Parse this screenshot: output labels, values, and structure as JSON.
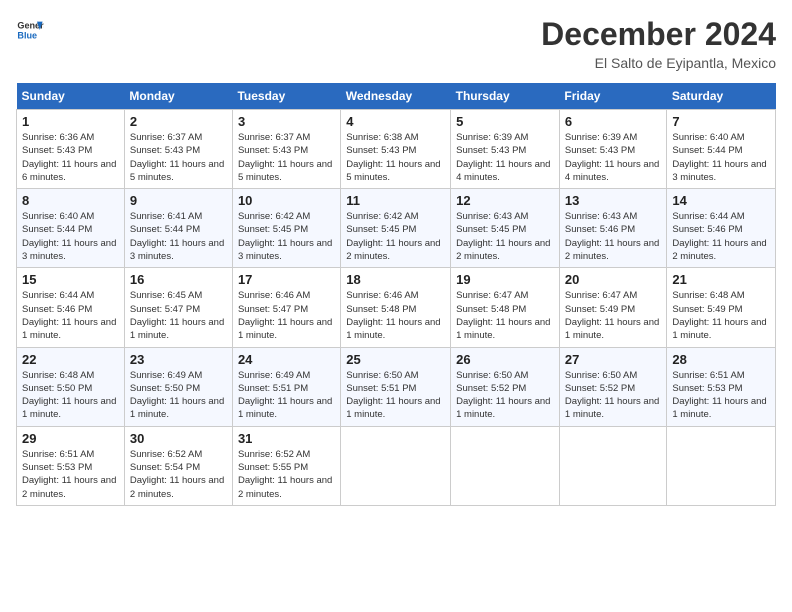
{
  "logo": {
    "general": "General",
    "blue": "Blue"
  },
  "title": "December 2024",
  "location": "El Salto de Eyipantla, Mexico",
  "days_of_week": [
    "Sunday",
    "Monday",
    "Tuesday",
    "Wednesday",
    "Thursday",
    "Friday",
    "Saturday"
  ],
  "weeks": [
    [
      {
        "day": "1",
        "sunrise": "6:36 AM",
        "sunset": "5:43 PM",
        "daylight": "11 hours and 6 minutes."
      },
      {
        "day": "2",
        "sunrise": "6:37 AM",
        "sunset": "5:43 PM",
        "daylight": "11 hours and 5 minutes."
      },
      {
        "day": "3",
        "sunrise": "6:37 AM",
        "sunset": "5:43 PM",
        "daylight": "11 hours and 5 minutes."
      },
      {
        "day": "4",
        "sunrise": "6:38 AM",
        "sunset": "5:43 PM",
        "daylight": "11 hours and 5 minutes."
      },
      {
        "day": "5",
        "sunrise": "6:39 AM",
        "sunset": "5:43 PM",
        "daylight": "11 hours and 4 minutes."
      },
      {
        "day": "6",
        "sunrise": "6:39 AM",
        "sunset": "5:43 PM",
        "daylight": "11 hours and 4 minutes."
      },
      {
        "day": "7",
        "sunrise": "6:40 AM",
        "sunset": "5:44 PM",
        "daylight": "11 hours and 3 minutes."
      }
    ],
    [
      {
        "day": "8",
        "sunrise": "6:40 AM",
        "sunset": "5:44 PM",
        "daylight": "11 hours and 3 minutes."
      },
      {
        "day": "9",
        "sunrise": "6:41 AM",
        "sunset": "5:44 PM",
        "daylight": "11 hours and 3 minutes."
      },
      {
        "day": "10",
        "sunrise": "6:42 AM",
        "sunset": "5:45 PM",
        "daylight": "11 hours and 3 minutes."
      },
      {
        "day": "11",
        "sunrise": "6:42 AM",
        "sunset": "5:45 PM",
        "daylight": "11 hours and 2 minutes."
      },
      {
        "day": "12",
        "sunrise": "6:43 AM",
        "sunset": "5:45 PM",
        "daylight": "11 hours and 2 minutes."
      },
      {
        "day": "13",
        "sunrise": "6:43 AM",
        "sunset": "5:46 PM",
        "daylight": "11 hours and 2 minutes."
      },
      {
        "day": "14",
        "sunrise": "6:44 AM",
        "sunset": "5:46 PM",
        "daylight": "11 hours and 2 minutes."
      }
    ],
    [
      {
        "day": "15",
        "sunrise": "6:44 AM",
        "sunset": "5:46 PM",
        "daylight": "11 hours and 1 minute."
      },
      {
        "day": "16",
        "sunrise": "6:45 AM",
        "sunset": "5:47 PM",
        "daylight": "11 hours and 1 minute."
      },
      {
        "day": "17",
        "sunrise": "6:46 AM",
        "sunset": "5:47 PM",
        "daylight": "11 hours and 1 minute."
      },
      {
        "day": "18",
        "sunrise": "6:46 AM",
        "sunset": "5:48 PM",
        "daylight": "11 hours and 1 minute."
      },
      {
        "day": "19",
        "sunrise": "6:47 AM",
        "sunset": "5:48 PM",
        "daylight": "11 hours and 1 minute."
      },
      {
        "day": "20",
        "sunrise": "6:47 AM",
        "sunset": "5:49 PM",
        "daylight": "11 hours and 1 minute."
      },
      {
        "day": "21",
        "sunrise": "6:48 AM",
        "sunset": "5:49 PM",
        "daylight": "11 hours and 1 minute."
      }
    ],
    [
      {
        "day": "22",
        "sunrise": "6:48 AM",
        "sunset": "5:50 PM",
        "daylight": "11 hours and 1 minute."
      },
      {
        "day": "23",
        "sunrise": "6:49 AM",
        "sunset": "5:50 PM",
        "daylight": "11 hours and 1 minute."
      },
      {
        "day": "24",
        "sunrise": "6:49 AM",
        "sunset": "5:51 PM",
        "daylight": "11 hours and 1 minute."
      },
      {
        "day": "25",
        "sunrise": "6:50 AM",
        "sunset": "5:51 PM",
        "daylight": "11 hours and 1 minute."
      },
      {
        "day": "26",
        "sunrise": "6:50 AM",
        "sunset": "5:52 PM",
        "daylight": "11 hours and 1 minute."
      },
      {
        "day": "27",
        "sunrise": "6:50 AM",
        "sunset": "5:52 PM",
        "daylight": "11 hours and 1 minute."
      },
      {
        "day": "28",
        "sunrise": "6:51 AM",
        "sunset": "5:53 PM",
        "daylight": "11 hours and 1 minute."
      }
    ],
    [
      {
        "day": "29",
        "sunrise": "6:51 AM",
        "sunset": "5:53 PM",
        "daylight": "11 hours and 2 minutes."
      },
      {
        "day": "30",
        "sunrise": "6:52 AM",
        "sunset": "5:54 PM",
        "daylight": "11 hours and 2 minutes."
      },
      {
        "day": "31",
        "sunrise": "6:52 AM",
        "sunset": "5:55 PM",
        "daylight": "11 hours and 2 minutes."
      },
      null,
      null,
      null,
      null
    ]
  ],
  "labels": {
    "sunrise": "Sunrise: ",
    "sunset": "Sunset: ",
    "daylight": "Daylight: "
  }
}
